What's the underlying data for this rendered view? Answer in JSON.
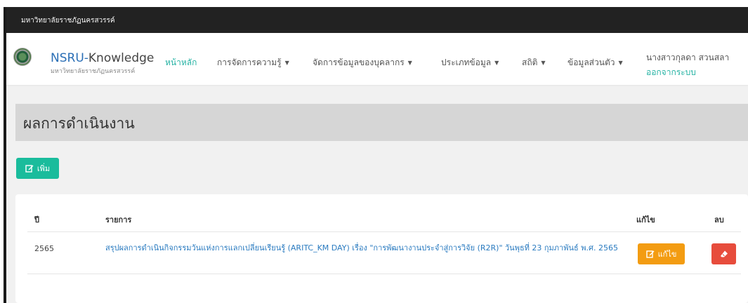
{
  "topbar": {
    "org": "มหาวิทยาลัยราชภัฏนครสวรรค์"
  },
  "brand": {
    "prefix": "NSRU-",
    "suffix": "Knowledge",
    "subtitle": "มหาวิทยาลัยราชภัฏนครสวรรค์"
  },
  "nav": {
    "items": [
      {
        "label": "หน้าหลัก"
      },
      {
        "label": "การจัดการความรู้"
      },
      {
        "label": "จัดการข้อมูลของบุคลากร"
      },
      {
        "label": "ประเภทข้อมูล"
      },
      {
        "label": "สถิติ"
      },
      {
        "label": "ข้อมูลส่วนตัว"
      }
    ]
  },
  "user": {
    "name": "นางสาวกุลดา สวนสลา",
    "logout": "ออกจากระบบ"
  },
  "page": {
    "title": "ผลการดำเนินงาน",
    "add_label": "เพิ่ม"
  },
  "table": {
    "headers": {
      "year": "ปี",
      "list": "รายการ",
      "edit": "แก้ไข",
      "delete": "ลบ"
    },
    "rows": [
      {
        "year": "2565",
        "title": "สรุปผลการดำเนินกิจกรรมวันแห่งการแลกเปลี่ยนเรียนรู้ (ARITC_KM DAY) เรื่อง \"การพัฒนางานประจำสู่การวิจัย (R2R)\" วันพุธที่ 23 กุมภาพันธ์ พ.ศ. 2565",
        "edit_label": "แก้ไข"
      }
    ]
  },
  "colors": {
    "accent": "#1abc9c",
    "link": "#2a7bc0",
    "edit": "#f39c12",
    "delete": "#e74c3c",
    "topbar": "#222222"
  },
  "icons": {
    "add": "edit-square-icon",
    "edit": "edit-square-icon",
    "delete": "eraser-icon"
  }
}
